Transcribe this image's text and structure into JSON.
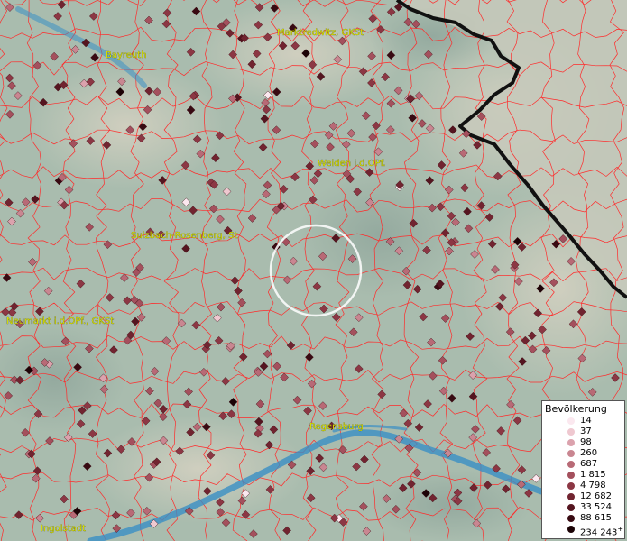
{
  "map": {
    "colors": {
      "terrain": "#a9bcae",
      "boundary": "#ff2a2a",
      "river": "#3a8fc4",
      "border": "#111111",
      "label": "#d8e000"
    },
    "places": [
      {
        "name": "Bayreuth"
      },
      {
        "name": "Marktredwitz, GKSt"
      },
      {
        "name": "Weiden i.d.OPf."
      },
      {
        "name": "Sulzbach-Rosenberg, St"
      },
      {
        "name": "Neumarkt i.d.OPf., GKSt"
      },
      {
        "name": "Regensburg"
      },
      {
        "name": "Ingolstadt"
      }
    ]
  },
  "legend": {
    "title": "Bevölkerung",
    "entries": [
      {
        "label": "14",
        "color": "#fbe8ef"
      },
      {
        "label": "37",
        "color": "#efc8d0"
      },
      {
        "label": "98",
        "color": "#dba2ad"
      },
      {
        "label": "260",
        "color": "#c98691"
      },
      {
        "label": "687",
        "color": "#b86a76"
      },
      {
        "label": "1 815",
        "color": "#a4505d"
      },
      {
        "label": "4 798",
        "color": "#8c3744"
      },
      {
        "label": "12 682",
        "color": "#712430"
      },
      {
        "label": "33 524",
        "color": "#551520"
      },
      {
        "label": "88 615",
        "color": "#380a12"
      },
      {
        "label": "234 243",
        "suffix": "+",
        "color": "#1c0306"
      }
    ]
  }
}
